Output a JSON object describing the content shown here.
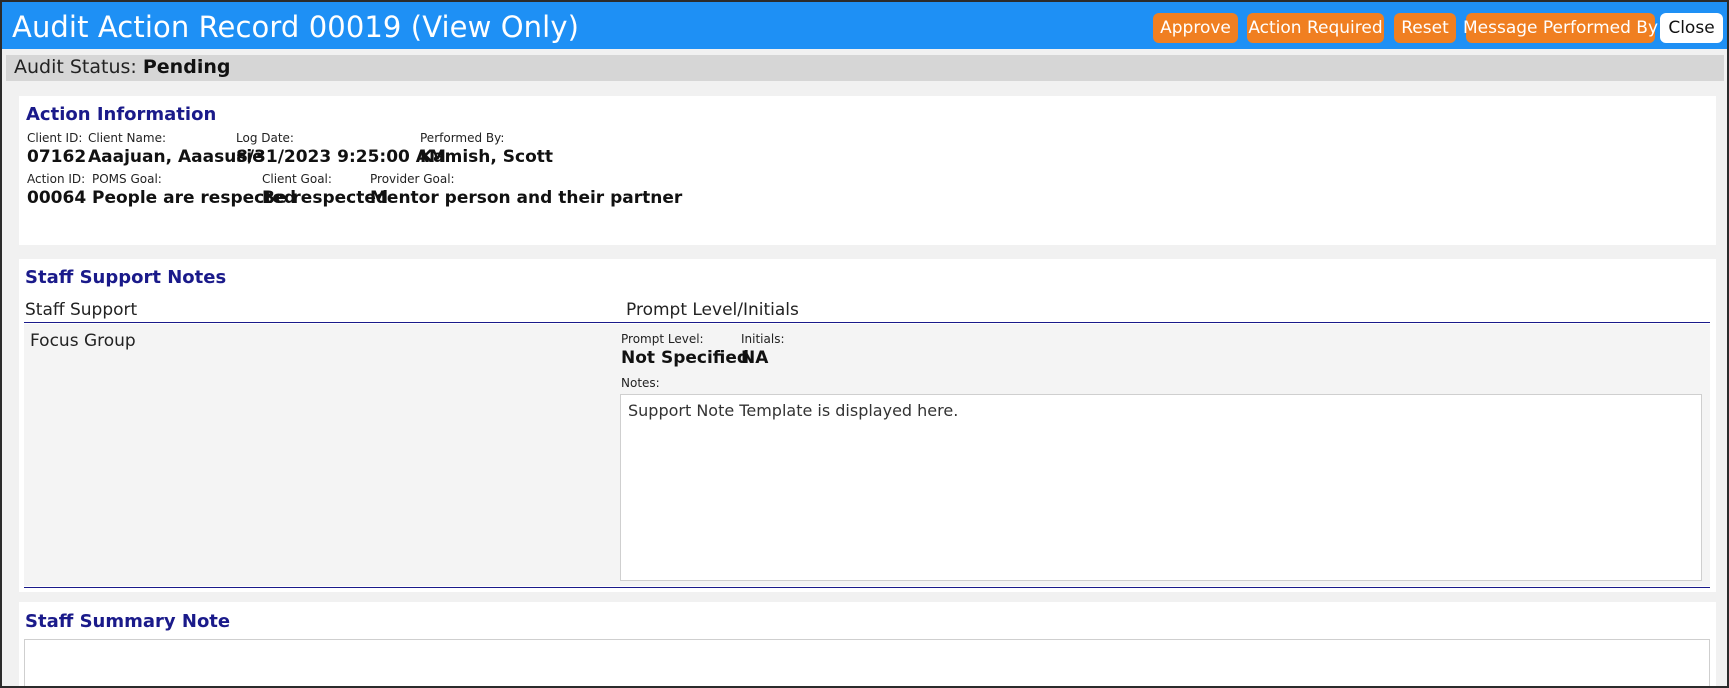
{
  "header": {
    "title": "Audit Action Record 00019 (View Only)",
    "buttons": {
      "approve": "Approve",
      "action_required": "Action Required",
      "reset": "Reset",
      "message_performed_by": "Message Performed By",
      "close": "Close"
    },
    "colors": {
      "titlebar": "#1e90f5",
      "button": "#f07f21"
    }
  },
  "status": {
    "label": "Audit Status:",
    "value": "Pending"
  },
  "action_info": {
    "title": "Action Information",
    "client_id_label": "Client ID:",
    "client_id": "07162",
    "client_name_label": "Client Name:",
    "client_name": "Aaajuan, Aaasusie",
    "log_date_label": "Log Date:",
    "log_date": "8/31/2023 9:25:00 AM",
    "performed_by_label": "Performed By:",
    "performed_by": "Kamish, Scott",
    "action_id_label": "Action ID:",
    "action_id": "00064",
    "poms_goal_label": "POMS Goal:",
    "poms_goal": "People are respected",
    "client_goal_label": "Client Goal:",
    "client_goal": "Be respected",
    "provider_goal_label": "Provider Goal:",
    "provider_goal": "Mentor person and their partner"
  },
  "staff_support": {
    "title": "Staff Support Notes",
    "col_support": "Staff Support",
    "col_prompt": "Prompt Level/Initials",
    "rows": [
      {
        "support": "Focus Group",
        "prompt_level_label": "Prompt Level:",
        "prompt_level": "Not Specified",
        "initials_label": "Initials:",
        "initials": "NA",
        "notes_label": "Notes:",
        "notes": "Support Note Template is displayed here."
      }
    ]
  },
  "summary": {
    "title": "Staff Summary Note"
  }
}
